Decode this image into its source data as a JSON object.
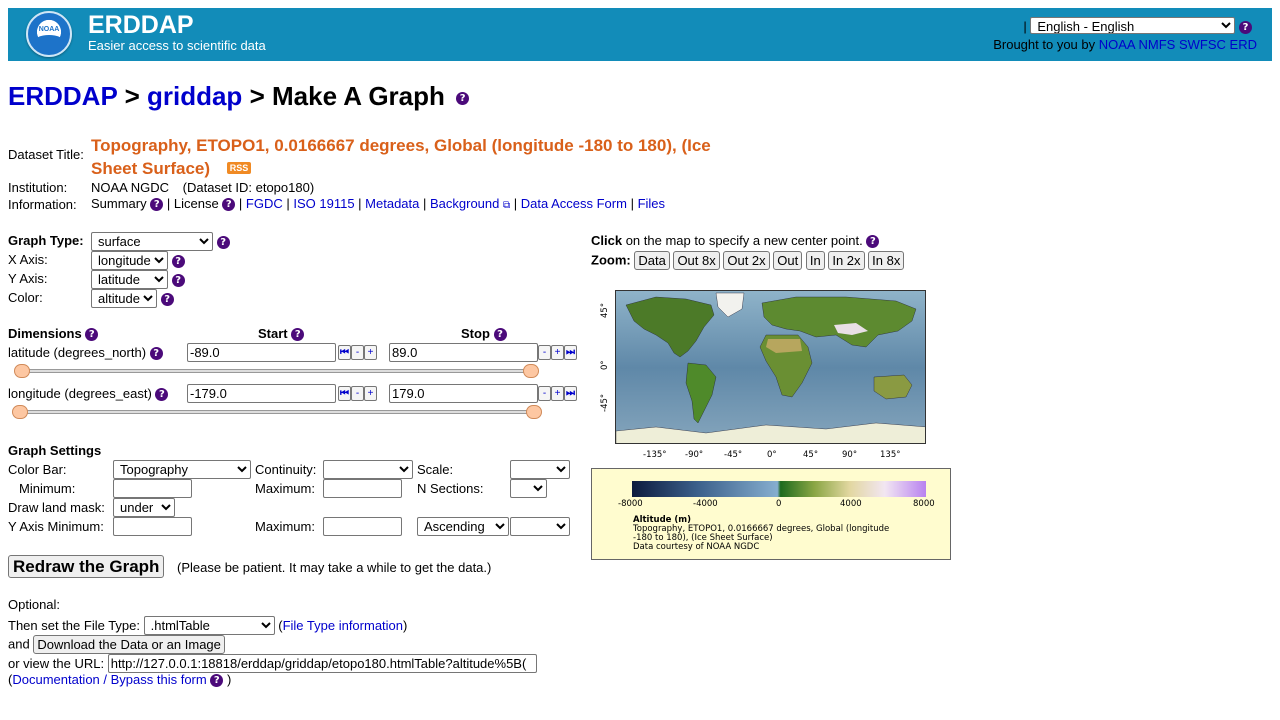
{
  "header": {
    "site_name": "ERDDAP",
    "tagline": "Easier access to scientific data",
    "logo_text": "NOAA",
    "lang_sep": "|",
    "language": "English - English",
    "brought_by": "Brought to you by",
    "brought_links": [
      "NOAA",
      "NMFS",
      "SWFSC",
      "ERD"
    ]
  },
  "breadcrumb": {
    "erddap": "ERDDAP",
    "sep1": ">",
    "griddap": "griddap",
    "sep2": ">",
    "page": "Make A Graph"
  },
  "info": {
    "dataset_title_label": "Dataset Title:",
    "dataset_title": "Topography, ETOPO1, 0.0166667 degrees, Global (longitude -180 to 180), (Ice Sheet Surface)",
    "rss": "RSS",
    "institution_label": "Institution:",
    "institution": "NOAA NGDC",
    "dataset_id": "(Dataset ID: etopo180)",
    "information_label": "Information:",
    "summary": "Summary",
    "license": "License",
    "links": {
      "fgdc": "FGDC",
      "iso": "ISO 19115",
      "metadata": "Metadata",
      "background": "Background",
      "data_access_form": "Data Access Form",
      "files": "Files"
    }
  },
  "graph": {
    "type_label": "Graph Type:",
    "type_value": "surface",
    "x_axis_label": "X Axis:",
    "x_axis_value": "longitude",
    "y_axis_label": "Y Axis:",
    "y_axis_value": "latitude",
    "color_label": "Color:",
    "color_value": "altitude"
  },
  "dimensions": {
    "header": "Dimensions",
    "start_header": "Start",
    "stop_header": "Stop",
    "rows": [
      {
        "label": "latitude (degrees_north)",
        "start": "-89.0",
        "stop": "89.0"
      },
      {
        "label": "longitude (degrees_east)",
        "start": "-179.0",
        "stop": "179.0"
      }
    ]
  },
  "settings": {
    "header": "Graph Settings",
    "color_bar_label": "Color Bar:",
    "color_bar_value": "Topography",
    "continuity_label": "Continuity:",
    "continuity_value": "",
    "scale_label": "Scale:",
    "scale_value": "",
    "minimum_label": "Minimum:",
    "minimum_value": "",
    "maximum_label": "Maximum:",
    "maximum_value": "",
    "nsections_label": "N Sections:",
    "nsections_value": "",
    "land_mask_label": "Draw land mask:",
    "land_mask_value": "under",
    "y_axis_min_label": "Y Axis Minimum:",
    "y_axis_min_value": "",
    "y_axis_max_label": "Maximum:",
    "y_axis_max_value": "",
    "order_value": "Ascending",
    "order_extra_value": ""
  },
  "redraw": {
    "button": "Redraw the Graph",
    "note": "(Please be patient. It may take a while to get the data.)"
  },
  "optional": {
    "label": "Optional:",
    "file_type_prefix": "Then set the File Type:",
    "file_type_value": ".htmlTable",
    "file_type_info": "File Type information",
    "and_label": "and",
    "download_button": "Download the Data or an Image",
    "url_prefix": "or view the URL:",
    "url_value": "http://127.0.0.1:18818/erddap/griddap/etopo180.htmlTable?altitude%5B(",
    "doc_link": "Documentation / Bypass this form"
  },
  "map_panel": {
    "click_bold": "Click",
    "click_rest": "on the map to specify a new center point.",
    "zoom_label": "Zoom:",
    "zoom_buttons": [
      "Data",
      "Out 8x",
      "Out 2x",
      "Out",
      "In",
      "In 2x",
      "In 8x"
    ],
    "x_ticks": [
      "-135°",
      "-90°",
      "-45°",
      "0°",
      "45°",
      "90°",
      "135°"
    ],
    "y_ticks": [
      "45°",
      "0°",
      "-45°"
    ]
  },
  "legend": {
    "ticks": [
      "-8000",
      "-4000",
      "0",
      "4000",
      "8000"
    ],
    "variable": "Altitude (m)",
    "desc1": "Topography, ETOPO1, 0.0166667 degrees, Global (longitude",
    "desc2": "-180 to 180), (Ice Sheet Surface)",
    "credit": "Data courtesy of NOAA NGDC"
  }
}
